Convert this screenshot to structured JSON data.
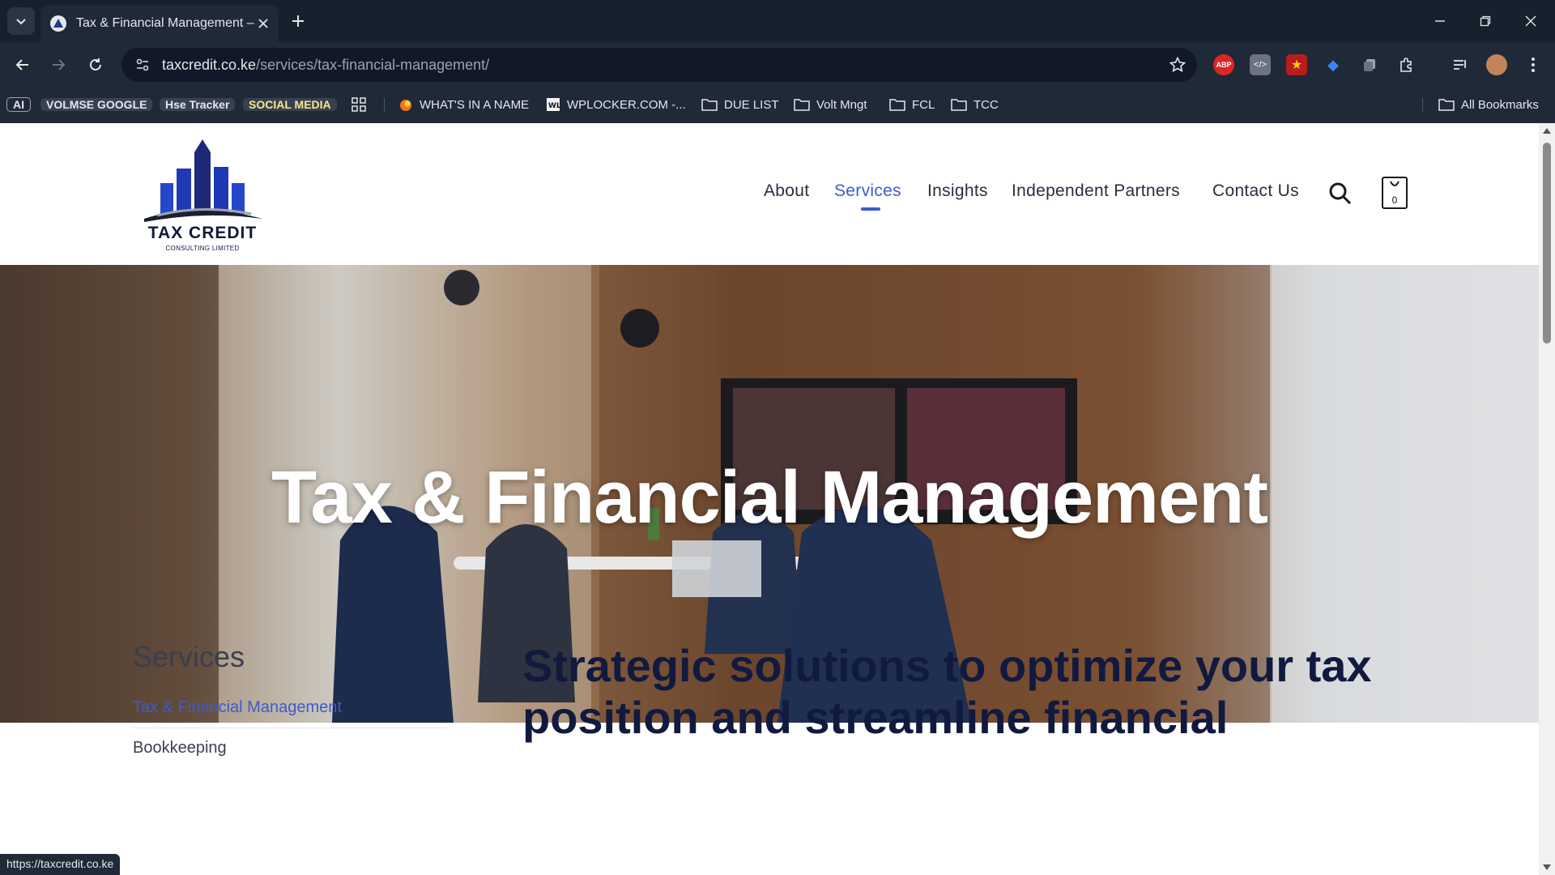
{
  "browser": {
    "tab_title": "Tax & Financial Management –",
    "url_host": "taxcredit.co.ke",
    "url_path": "/services/tax-financial-management/",
    "bookmarks": [
      {
        "label": "AI",
        "style": "outline"
      },
      {
        "label": "VOLMSE GOOGLE",
        "style": "chip"
      },
      {
        "label": "Hse Tracker",
        "style": "chip"
      },
      {
        "label": "SOCIAL MEDIA",
        "style": "gold"
      },
      {
        "label": "WHAT'S IN A NAME",
        "style": "link"
      },
      {
        "label": "WPLOCKER.COM -...",
        "style": "link"
      },
      {
        "label": "DUE LIST",
        "style": "folder"
      },
      {
        "label": "Volt Mngt",
        "style": "folder"
      },
      {
        "label": "FCL",
        "style": "folder"
      },
      {
        "label": "TCC",
        "style": "folder"
      }
    ],
    "all_bookmarks": "All Bookmarks",
    "status_url": "https://taxcredit.co.ke"
  },
  "site": {
    "logo_name": "TAX CREDIT",
    "logo_sub": "CONSULTING LIMITED",
    "nav": [
      "About",
      "Services",
      "Insights",
      "Independent Partners",
      "Contact Us"
    ],
    "active_nav": "Services",
    "cart_count": "0"
  },
  "hero": {
    "title": "Tax & Financial Management"
  },
  "sidebar": {
    "title": "Services",
    "items": [
      "Tax & Financial Management",
      "Bookkeeping"
    ]
  },
  "main": {
    "lead": "Strategic solutions to optimize your tax position and streamline financial"
  },
  "colors": {
    "accent": "#3b5ccc",
    "navy": "#121a3a",
    "chrome": "#1f2937"
  }
}
